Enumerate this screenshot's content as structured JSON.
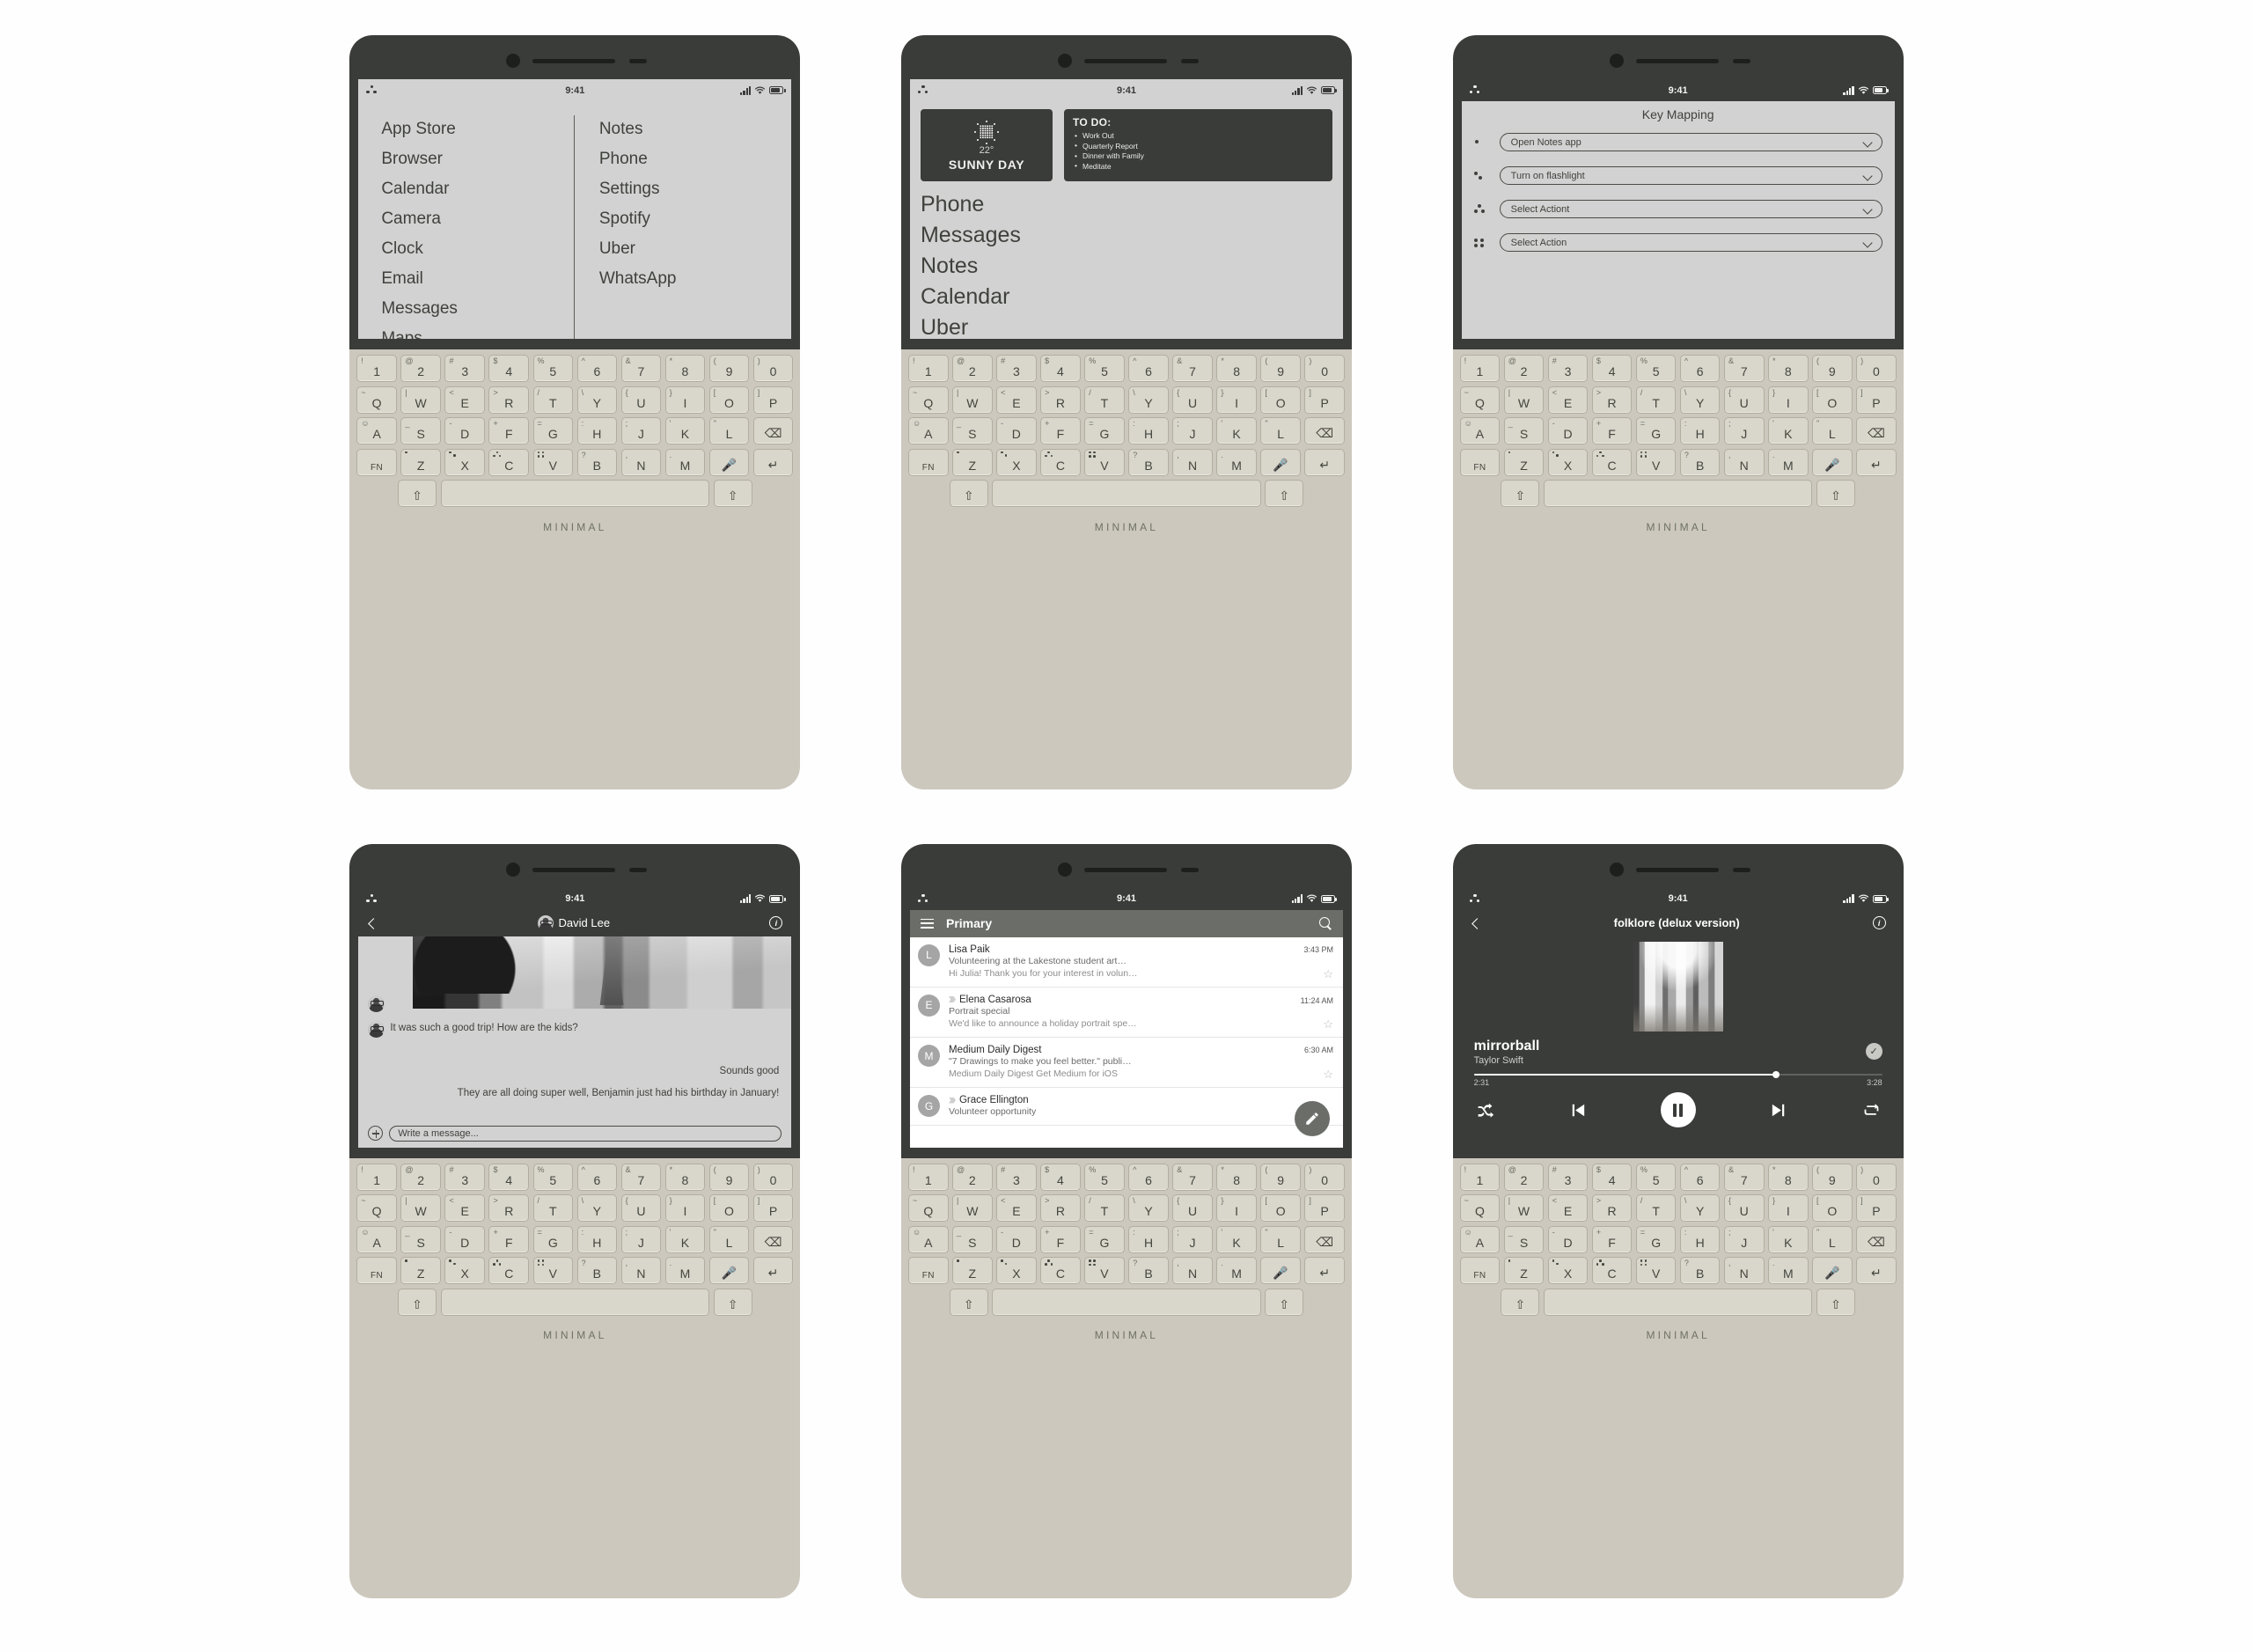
{
  "brand": "MINIMAL",
  "status": {
    "time": "9:41",
    "logo_icon": "three-dot-logo-icon",
    "signal_icon": "signal-bars-icon",
    "wifi_icon": "wifi-icon",
    "battery_icon": "battery-icon"
  },
  "keyboard": {
    "brand": "MINIMAL",
    "row_numbers": [
      {
        "sup": "!",
        "main": "1"
      },
      {
        "sup": "@",
        "main": "2"
      },
      {
        "sup": "#",
        "main": "3"
      },
      {
        "sup": "$",
        "main": "4"
      },
      {
        "sup": "%",
        "main": "5"
      },
      {
        "sup": "^",
        "main": "6"
      },
      {
        "sup": "&",
        "main": "7"
      },
      {
        "sup": "*",
        "main": "8"
      },
      {
        "sup": "(",
        "main": "9"
      },
      {
        "sup": ")",
        "main": "0"
      }
    ],
    "row_q": [
      {
        "sup": "~",
        "main": "Q"
      },
      {
        "sup": "|",
        "main": "W"
      },
      {
        "sup": "<",
        "main": "E"
      },
      {
        "sup": ">",
        "main": "R"
      },
      {
        "sup": "/",
        "main": "T"
      },
      {
        "sup": "\\",
        "main": "Y"
      },
      {
        "sup": "{",
        "main": "U"
      },
      {
        "sup": "}",
        "main": "I"
      },
      {
        "sup": "[",
        "main": "O"
      },
      {
        "sup": "]",
        "main": "P"
      }
    ],
    "row_a": [
      {
        "sup": "☺",
        "main": "A"
      },
      {
        "sup": "_",
        "main": "S"
      },
      {
        "sup": "-",
        "main": "D"
      },
      {
        "sup": "+",
        "main": "F"
      },
      {
        "sup": "=",
        "main": "G"
      },
      {
        "sup": ":",
        "main": "H"
      },
      {
        "sup": ";",
        "main": "J"
      },
      {
        "sup": "'",
        "main": "K"
      },
      {
        "sup": "\"",
        "main": "L"
      }
    ],
    "backspace_label": "⌫",
    "row_z": [
      {
        "sup": "",
        "main": "Z",
        "dots": 1
      },
      {
        "sup": "",
        "main": "X",
        "dots": 2
      },
      {
        "sup": "",
        "main": "C",
        "dots": 3
      },
      {
        "sup": "",
        "main": "V",
        "dots": 4
      },
      {
        "sup": "?",
        "main": "B",
        "dots": 0
      },
      {
        "sup": ",",
        "main": "N",
        "dots": 0
      },
      {
        "sup": ".",
        "main": "M",
        "dots": 0
      }
    ],
    "fn_label": "FN",
    "mic_label": "🎤",
    "enter_label": "↵",
    "shift_label": "⇧",
    "space_label": ""
  },
  "screen_apps": {
    "left_column": [
      "App Store",
      "Browser",
      "Calendar",
      "Camera",
      "Clock",
      "Email",
      "Messages",
      "Maps"
    ],
    "right_column": [
      "Notes",
      "Phone",
      "Settings",
      "Spotify",
      "Uber",
      "WhatsApp"
    ]
  },
  "screen_home": {
    "weather": {
      "icon": "sun-icon",
      "temperature": "22°",
      "label": "SUNNY DAY"
    },
    "todo": {
      "title": "TO DO:",
      "items": [
        "Work Out",
        "Quarterly Report",
        "Dinner with Family",
        "Meditate"
      ]
    },
    "apps": [
      "Phone",
      "Messages",
      "Notes",
      "Calendar",
      "Uber"
    ]
  },
  "screen_keymap": {
    "title": "Key Mapping",
    "rows": [
      {
        "dots": 1,
        "value": "Open Notes app"
      },
      {
        "dots": 2,
        "value": "Turn on flashlight"
      },
      {
        "dots": 3,
        "value": "Select Actiont"
      },
      {
        "dots": 4,
        "value": "Select Action"
      }
    ]
  },
  "screen_chat": {
    "contact": "David Lee",
    "back_icon": "back-chevron-icon",
    "info_icon": "info-icon",
    "avatar_icon": "contact-avatar",
    "photo_icon": "paris-photo",
    "messages": [
      {
        "side": "in",
        "text": "It was such a good trip! How are the kids?"
      },
      {
        "side": "out",
        "text": "Sounds good"
      },
      {
        "side": "out",
        "text": "They are all doing super well, Benjamin just had his birthday in January!"
      }
    ],
    "input_placeholder": "Write a message...",
    "attach_icon": "plus-icon"
  },
  "screen_mail": {
    "title": "Primary",
    "menu_icon": "hamburger-menu-icon",
    "search_icon": "search-icon",
    "compose_icon": "pencil-icon",
    "rows": [
      {
        "initial": "L",
        "from": "Lisa Paik",
        "time": "3:43 PM",
        "subject": "Volunteering at the Lakestone student art…",
        "snippet": "Hi Julia! Thank you for your interest in volun…",
        "important": false
      },
      {
        "initial": "E",
        "from": "Elena Casarosa",
        "time": "11:24 AM",
        "subject": "Portrait special",
        "snippet": "We'd like to announce a holiday portrait spe…",
        "important": true
      },
      {
        "initial": "M",
        "from": "Medium Daily Digest",
        "time": "6:30 AM",
        "subject": "\"7 Drawings to make you feel better.\" publi…",
        "snippet": "Medium Daily Digest Get Medium for iOS",
        "important": false
      },
      {
        "initial": "G",
        "from": "Grace Ellington",
        "time": "",
        "subject": "Volunteer opportunity",
        "snippet": "",
        "important": true
      }
    ],
    "star_icon": "star-outline-icon"
  },
  "screen_player": {
    "album": "folklore (delux version)",
    "song": "mirrorball",
    "artist": "Taylor Swift",
    "elapsed": "2:31",
    "duration": "3:28",
    "progress_percent": 74,
    "back_icon": "back-chevron-icon",
    "info_icon": "info-icon",
    "check_icon": "check-icon",
    "artwork_icon": "forest-album-art",
    "controls": {
      "shuffle": "shuffle-icon",
      "previous": "previous-track-icon",
      "play_pause": "pause-icon",
      "next": "next-track-icon",
      "repeat": "repeat-icon"
    }
  }
}
